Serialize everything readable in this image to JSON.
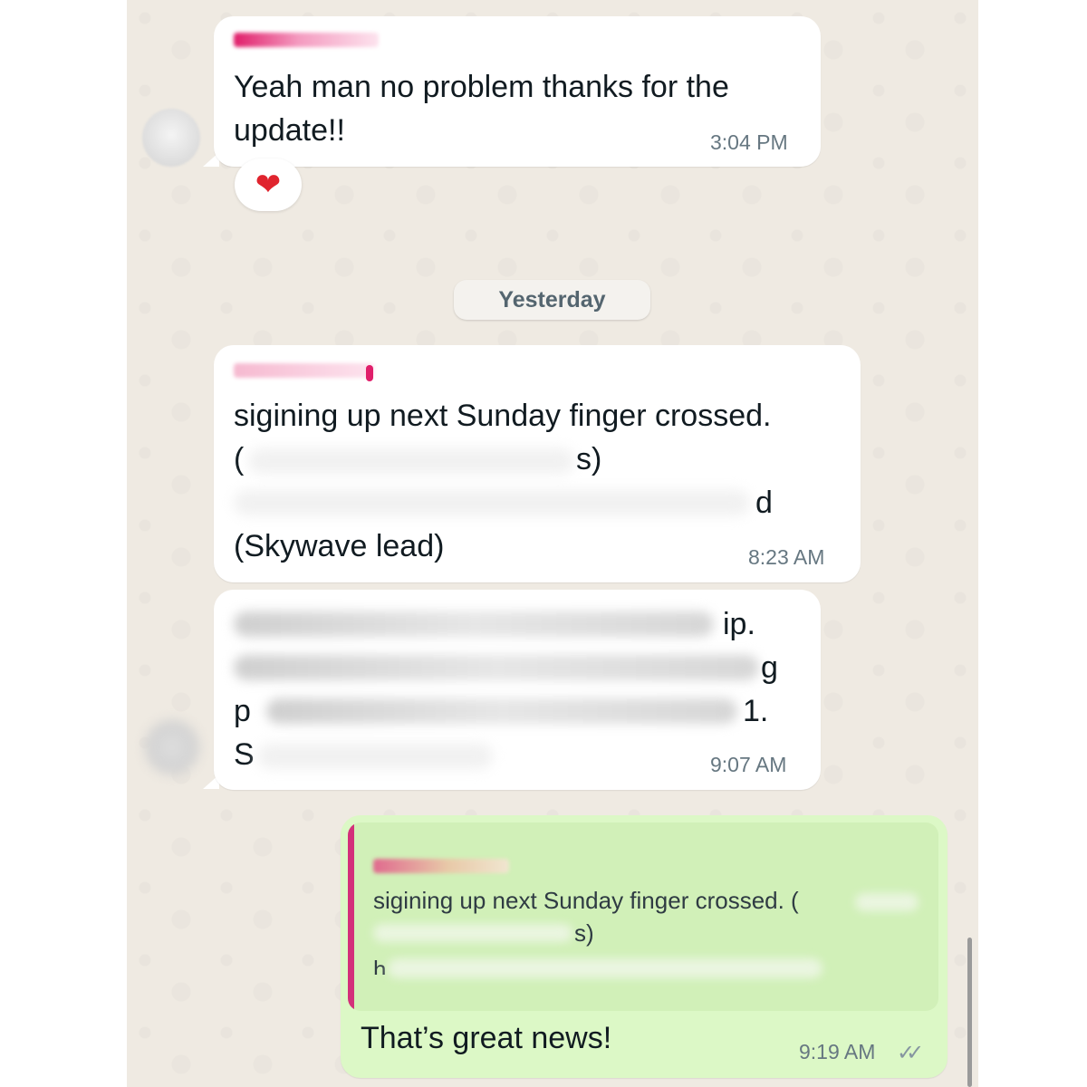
{
  "messages": [
    {
      "id": "m1",
      "direction": "incoming",
      "text_lines": [
        "Yeah man no problem thanks for the",
        "update!!"
      ],
      "time": "3:04 PM",
      "reaction": "❤"
    },
    {
      "id": "m2",
      "direction": "incoming",
      "text_lines": [
        "sigining up next Sunday finger crossed.",
        "(",
        "s)",
        "d",
        "(Skywave lead)"
      ],
      "time": "8:23 AM"
    },
    {
      "id": "m3",
      "direction": "incoming",
      "text_lines": [
        "ip.",
        "g",
        "p",
        "1.",
        "S"
      ],
      "time": "9:07 AM"
    },
    {
      "id": "m4",
      "direction": "outgoing",
      "quoted_lines": [
        "sigining up next Sunday finger crossed. (",
        "s)",
        "h"
      ],
      "text": "That’s great news!",
      "time": "9:19 AM",
      "status_icon": "double-check-icon"
    }
  ],
  "date_separator": "Yesterday",
  "colors": {
    "chat_background": "#efeae2",
    "incoming_bubble": "#ffffff",
    "outgoing_bubble": "#dcf8c6",
    "quote_accent": "#d3307a",
    "sender_name": "#e01e6a",
    "timestamp": "#667781"
  }
}
